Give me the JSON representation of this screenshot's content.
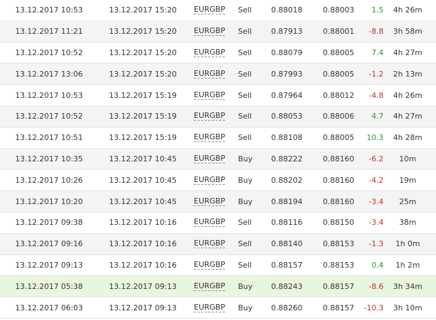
{
  "colors": {
    "profit": "#1f9e2a",
    "loss": "#d0282a",
    "row_alt": "#f4f4f4",
    "row_highlight": "#e8f6e0"
  },
  "trades": [
    {
      "open_time": "13.12.2017 10:53",
      "close_time": "13.12.2017 15:20",
      "symbol": "EURGBP",
      "type": "Sell",
      "open_price": "0.88018",
      "close_price": "0.88003",
      "pips": "1.5",
      "duration": "4h 26m",
      "result": "pos",
      "highlight": false
    },
    {
      "open_time": "13.12.2017 11:21",
      "close_time": "13.12.2017 15:20",
      "symbol": "EURGBP",
      "type": "Sell",
      "open_price": "0.87913",
      "close_price": "0.88001",
      "pips": "-8.8",
      "duration": "3h 58m",
      "result": "neg",
      "highlight": false
    },
    {
      "open_time": "13.12.2017 10:52",
      "close_time": "13.12.2017 15:20",
      "symbol": "EURGBP",
      "type": "Sell",
      "open_price": "0.88079",
      "close_price": "0.88005",
      "pips": "7.4",
      "duration": "4h 27m",
      "result": "pos",
      "highlight": false
    },
    {
      "open_time": "13.12.2017 13:06",
      "close_time": "13.12.2017 15:20",
      "symbol": "EURGBP",
      "type": "Sell",
      "open_price": "0.87993",
      "close_price": "0.88005",
      "pips": "-1.2",
      "duration": "2h 13m",
      "result": "neg",
      "highlight": false
    },
    {
      "open_time": "13.12.2017 10:53",
      "close_time": "13.12.2017 15:19",
      "symbol": "EURGBP",
      "type": "Sell",
      "open_price": "0.87964",
      "close_price": "0.88012",
      "pips": "-4.8",
      "duration": "4h 26m",
      "result": "neg",
      "highlight": false
    },
    {
      "open_time": "13.12.2017 10:52",
      "close_time": "13.12.2017 15:19",
      "symbol": "EURGBP",
      "type": "Sell",
      "open_price": "0.88053",
      "close_price": "0.88006",
      "pips": "4.7",
      "duration": "4h 27m",
      "result": "pos",
      "highlight": false
    },
    {
      "open_time": "13.12.2017 10:51",
      "close_time": "13.12.2017 15:19",
      "symbol": "EURGBP",
      "type": "Sell",
      "open_price": "0.88108",
      "close_price": "0.88005",
      "pips": "10.3",
      "duration": "4h 28m",
      "result": "pos",
      "highlight": false
    },
    {
      "open_time": "13.12.2017 10:35",
      "close_time": "13.12.2017 10:45",
      "symbol": "EURGBP",
      "type": "Buy",
      "open_price": "0.88222",
      "close_price": "0.88160",
      "pips": "-6.2",
      "duration": "10m",
      "result": "neg",
      "highlight": false
    },
    {
      "open_time": "13.12.2017 10:26",
      "close_time": "13.12.2017 10:45",
      "symbol": "EURGBP",
      "type": "Buy",
      "open_price": "0.88202",
      "close_price": "0.88160",
      "pips": "-4.2",
      "duration": "19m",
      "result": "neg",
      "highlight": false
    },
    {
      "open_time": "13.12.2017 10:20",
      "close_time": "13.12.2017 10:45",
      "symbol": "EURGBP",
      "type": "Buy",
      "open_price": "0.88194",
      "close_price": "0.88160",
      "pips": "-3.4",
      "duration": "25m",
      "result": "neg",
      "highlight": false
    },
    {
      "open_time": "13.12.2017 09:38",
      "close_time": "13.12.2017 10:16",
      "symbol": "EURGBP",
      "type": "Sell",
      "open_price": "0.88116",
      "close_price": "0.88150",
      "pips": "-3.4",
      "duration": "38m",
      "result": "neg",
      "highlight": false
    },
    {
      "open_time": "13.12.2017 09:16",
      "close_time": "13.12.2017 10:16",
      "symbol": "EURGBP",
      "type": "Sell",
      "open_price": "0.88140",
      "close_price": "0.88153",
      "pips": "-1.3",
      "duration": "1h 0m",
      "result": "neg",
      "highlight": false
    },
    {
      "open_time": "13.12.2017 09:13",
      "close_time": "13.12.2017 10:16",
      "symbol": "EURGBP",
      "type": "Sell",
      "open_price": "0.88157",
      "close_price": "0.88153",
      "pips": "0.4",
      "duration": "1h 2m",
      "result": "pos",
      "highlight": false
    },
    {
      "open_time": "13.12.2017 05:38",
      "close_time": "13.12.2017 09:13",
      "symbol": "EURGBP",
      "type": "Buy",
      "open_price": "0.88243",
      "close_price": "0.88157",
      "pips": "-8.6",
      "duration": "3h 34m",
      "result": "neg",
      "highlight": true
    },
    {
      "open_time": "13.12.2017 06:03",
      "close_time": "13.12.2017 09:13",
      "symbol": "EURGBP",
      "type": "Buy",
      "open_price": "0.88260",
      "close_price": "0.88157",
      "pips": "-10.3",
      "duration": "3h 10m",
      "result": "neg",
      "highlight": false
    }
  ]
}
